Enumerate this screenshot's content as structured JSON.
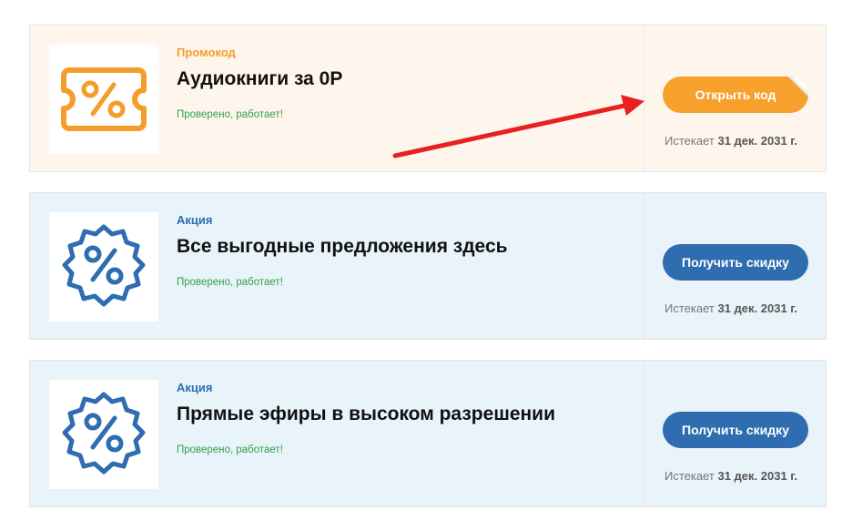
{
  "offers": [
    {
      "type_label": "Промокод",
      "title": "Аудиокниги за 0Р",
      "verified": "Проверено, работает!",
      "button_label": "Открыть код",
      "expires_prefix": "Истекает",
      "expires_date": "31 дек. 2031 г.",
      "icon": "ticket-percent-icon"
    },
    {
      "type_label": "Акция",
      "title": "Все выгодные предложения здесь",
      "verified": "Проверено, работает!",
      "button_label": "Получить скидку",
      "expires_prefix": "Истекает",
      "expires_date": "31 дек. 2031 г.",
      "icon": "badge-percent-icon"
    },
    {
      "type_label": "Акция",
      "title": "Прямые эфиры в высоком разрешении",
      "verified": "Проверено, работает!",
      "button_label": "Получить скидку",
      "expires_prefix": "Истекает",
      "expires_date": "31 дек. 2031 г.",
      "icon": "badge-percent-icon"
    }
  ],
  "colors": {
    "promo_accent": "#f7a02c",
    "deal_accent": "#2f6db0",
    "promo_bg": "#fef6ec",
    "deal_bg": "#e8f3fa",
    "verified_green": "#35a04a",
    "annotation_arrow": "#e8201f"
  },
  "annotation": {
    "icon": "red-arrow-icon"
  }
}
